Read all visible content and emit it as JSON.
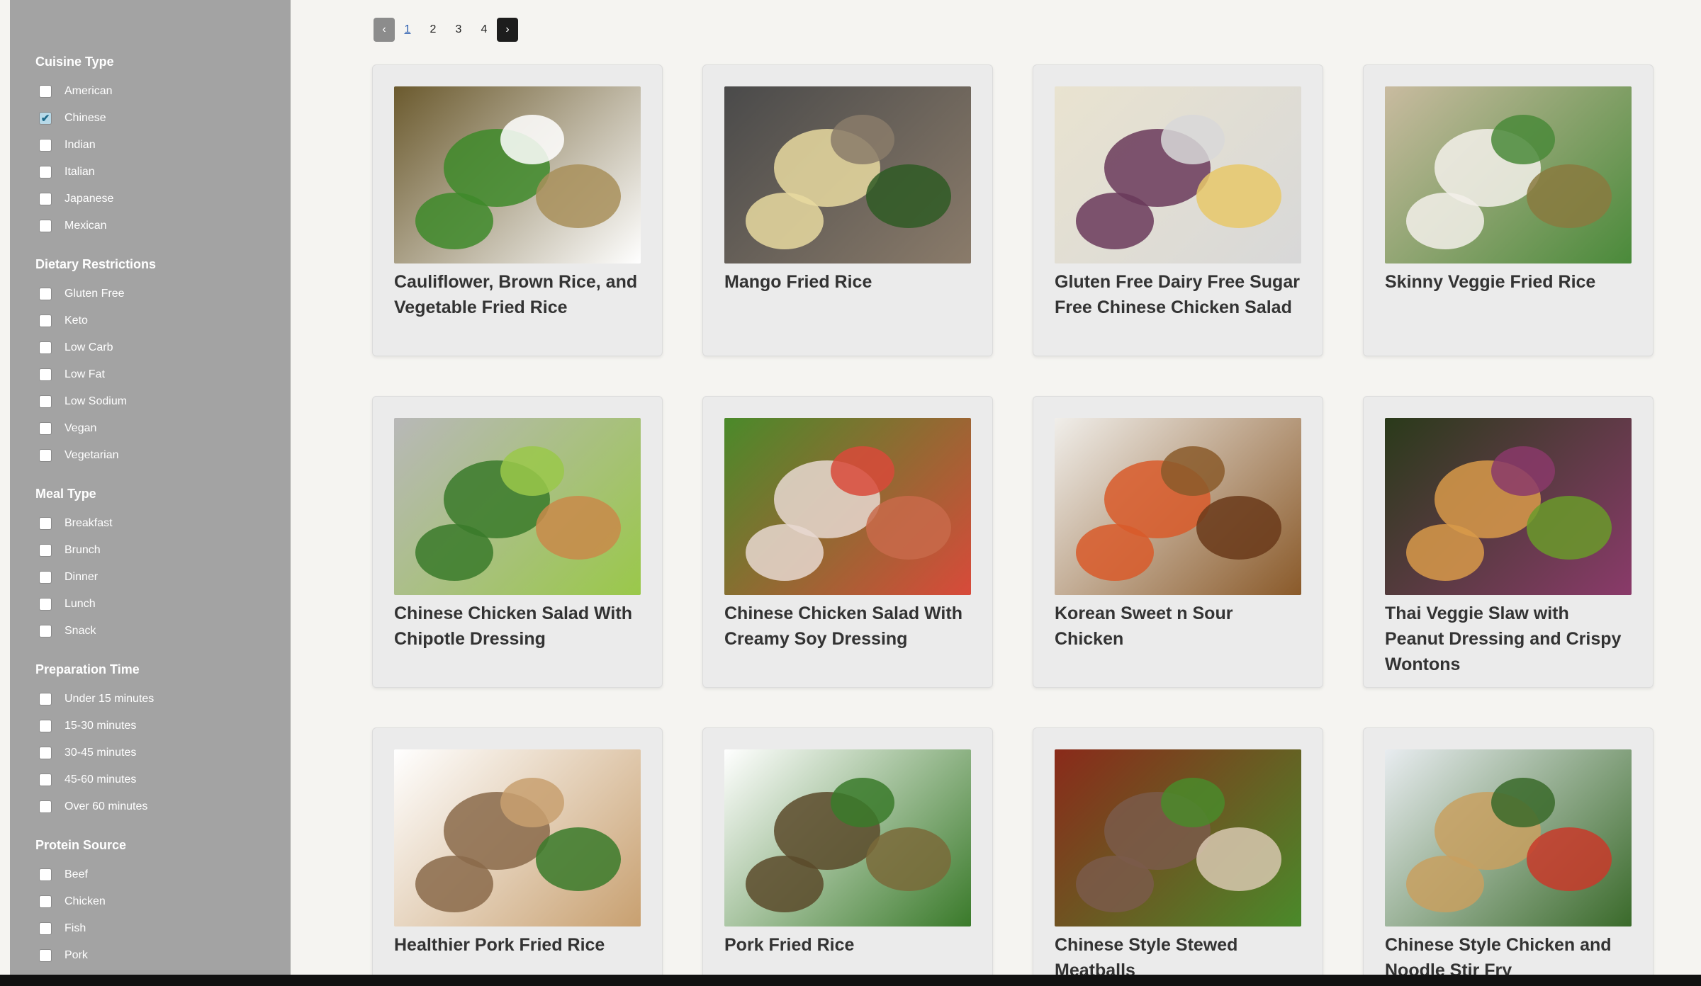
{
  "sidebar": {
    "groups": [
      {
        "title": "Cuisine Type",
        "options": [
          {
            "label": "American",
            "checked": false
          },
          {
            "label": "Chinese",
            "checked": true
          },
          {
            "label": "Indian",
            "checked": false
          },
          {
            "label": "Italian",
            "checked": false
          },
          {
            "label": "Japanese",
            "checked": false
          },
          {
            "label": "Mexican",
            "checked": false
          }
        ]
      },
      {
        "title": "Dietary Restrictions",
        "options": [
          {
            "label": "Gluten Free",
            "checked": false
          },
          {
            "label": "Keto",
            "checked": false
          },
          {
            "label": "Low Carb",
            "checked": false
          },
          {
            "label": "Low Fat",
            "checked": false
          },
          {
            "label": "Low Sodium",
            "checked": false
          },
          {
            "label": "Vegan",
            "checked": false
          },
          {
            "label": "Vegetarian",
            "checked": false
          }
        ]
      },
      {
        "title": "Meal Type",
        "options": [
          {
            "label": "Breakfast",
            "checked": false
          },
          {
            "label": "Brunch",
            "checked": false
          },
          {
            "label": "Dinner",
            "checked": false
          },
          {
            "label": "Lunch",
            "checked": false
          },
          {
            "label": "Snack",
            "checked": false
          }
        ]
      },
      {
        "title": "Preparation Time",
        "options": [
          {
            "label": "Under 15 minutes",
            "checked": false
          },
          {
            "label": "15-30 minutes",
            "checked": false
          },
          {
            "label": "30-45 minutes",
            "checked": false
          },
          {
            "label": "45-60 minutes",
            "checked": false
          },
          {
            "label": "Over 60 minutes",
            "checked": false
          }
        ]
      },
      {
        "title": "Protein Source",
        "options": [
          {
            "label": "Beef",
            "checked": false
          },
          {
            "label": "Chicken",
            "checked": false
          },
          {
            "label": "Fish",
            "checked": false
          },
          {
            "label": "Pork",
            "checked": false
          }
        ]
      }
    ]
  },
  "pagination": {
    "prev_label": "‹",
    "next_label": "›",
    "pages": [
      "1",
      "2",
      "3",
      "4"
    ],
    "current": "1"
  },
  "recipes": [
    {
      "title": "Cauliflower, Brown Rice, and Vegetable Fried Rice",
      "palette": [
        "#6b5a2e",
        "#3e8a2a",
        "#a88f5a",
        "#ffffff"
      ]
    },
    {
      "title": "Mango Fried Rice",
      "palette": [
        "#4a4a4a",
        "#e8d9a0",
        "#2f5a25",
        "#8a7b6a"
      ]
    },
    {
      "title": "Gluten Free Dairy Free Sugar Free Chinese Chicken Salad",
      "palette": [
        "#e9e3d0",
        "#6a3a5a",
        "#e8c86a",
        "#d8d8d8"
      ]
    },
    {
      "title": "Skinny Veggie Fried Rice",
      "palette": [
        "#c9bba0",
        "#f3f0ea",
        "#8a7a40",
        "#4a8a3a"
      ]
    },
    {
      "title": "Chinese Chicken Salad With Chipotle Dressing",
      "palette": [
        "#b8b8b8",
        "#3a7a2a",
        "#c98a4a",
        "#9ac84a"
      ]
    },
    {
      "title": "Chinese Chicken Salad With Creamy Soy Dressing",
      "palette": [
        "#4a8a2a",
        "#e8d8d0",
        "#c86a4a",
        "#d84a3a"
      ]
    },
    {
      "title": "Korean Sweet n Sour Chicken",
      "palette": [
        "#f0eeea",
        "#d85a2a",
        "#6a3a1a",
        "#8a5a2a"
      ]
    },
    {
      "title": "Thai Veggie Slaw with Peanut Dressing and Crispy Wontons",
      "palette": [
        "#2a3a1a",
        "#d89a4a",
        "#6a9a2a",
        "#8a3a6a"
      ]
    },
    {
      "title": "Healthier Pork Fried Rice",
      "palette": [
        "#ffffff",
        "#8a6a4a",
        "#3a7a2a",
        "#c8a070"
      ]
    },
    {
      "title": "Pork Fried Rice",
      "palette": [
        "#ffffff",
        "#5a4a2a",
        "#7a6a3a",
        "#3a7a2a"
      ]
    },
    {
      "title": "Chinese Style Stewed Meatballs",
      "palette": [
        "#8a2a1a",
        "#7a5a4a",
        "#d8c8b0",
        "#4a8a2a"
      ]
    },
    {
      "title": "Chinese Style Chicken and Noodle Stir Fry",
      "palette": [
        "#e8ecf0",
        "#c8a060",
        "#c83a2a",
        "#3a6a2a"
      ]
    }
  ]
}
